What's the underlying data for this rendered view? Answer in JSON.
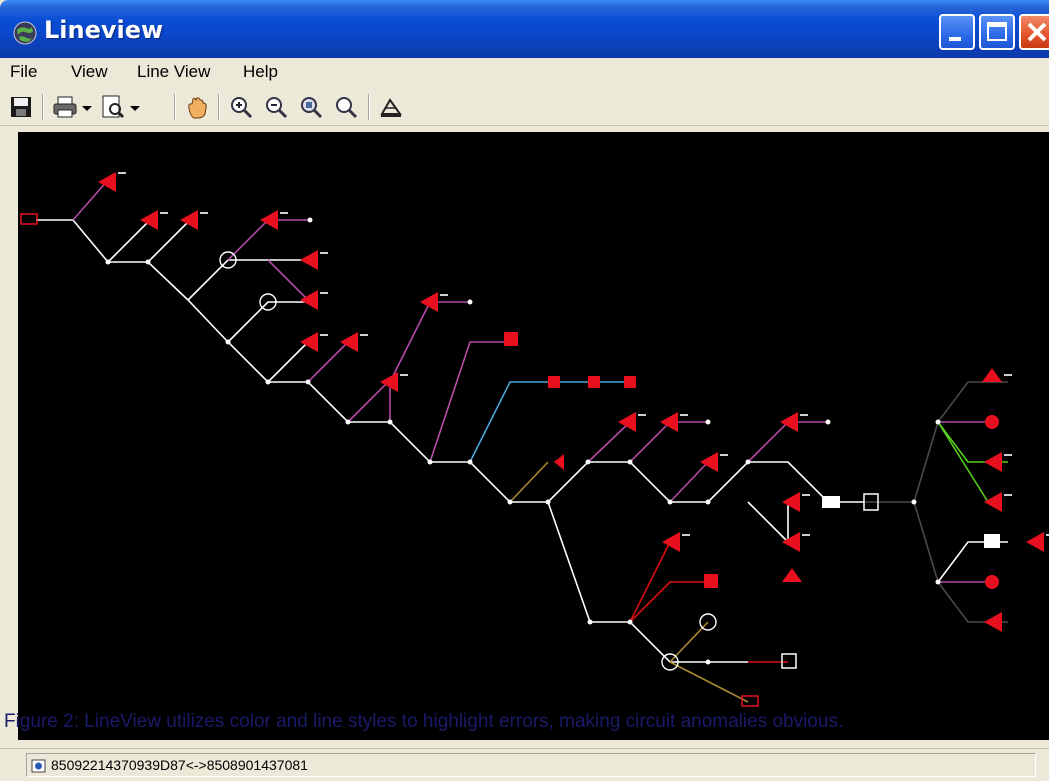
{
  "window": {
    "title": "Lineview"
  },
  "menu": {
    "items": [
      "File",
      "View",
      "Line View",
      "Help"
    ]
  },
  "toolbar": {
    "tools": [
      "save-icon",
      "print-icon",
      "print-preview-icon",
      "pan-hand-icon",
      "zoom-in-icon",
      "zoom-out-icon",
      "zoom-window-icon",
      "zoom-fit-icon",
      "tree-layout-icon"
    ]
  },
  "caption": {
    "text": "Figure 2: LineView utilizes color and line styles to highlight errors, making circuit anomalies obvious."
  },
  "status": {
    "text": "85092214370939D87<->8508901437081"
  },
  "colors": {
    "canvas": "#000000",
    "device_red": "#e8101e",
    "line_white": "#ffffff",
    "line_purple": "#b44aa8",
    "line_blue": "#4aa8d8",
    "line_green": "#5ad01e",
    "line_gold": "#a88830",
    "line_red": "#d81010",
    "titlebar_blue": "#0a46c8"
  }
}
